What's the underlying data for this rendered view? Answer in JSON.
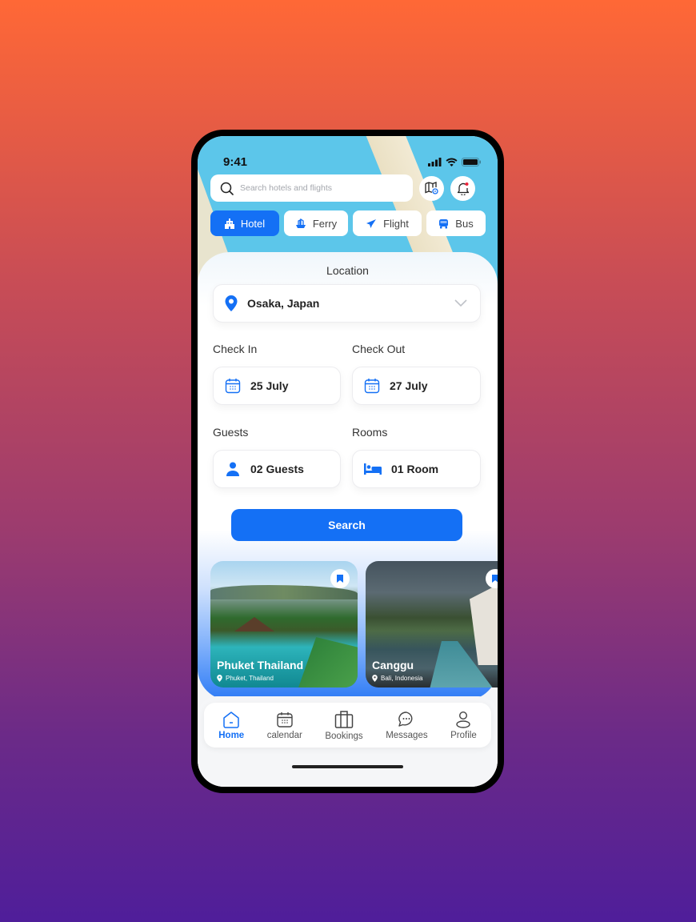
{
  "status_bar": {
    "time": "9:41"
  },
  "search": {
    "placeholder": "Search hotels and flights"
  },
  "header_icons": [
    "map-icon",
    "bell-icon"
  ],
  "tabs": [
    {
      "label": "Hotel",
      "icon": "hotel-icon",
      "active": true
    },
    {
      "label": "Ferry",
      "icon": "ferry-icon",
      "active": false
    },
    {
      "label": "Flight",
      "icon": "plane-icon",
      "active": false
    },
    {
      "label": "Bus",
      "icon": "bus-icon",
      "active": false
    }
  ],
  "form": {
    "location_label": "Location",
    "location_value": "Osaka, Japan",
    "check_in_label": "Check In",
    "check_in_value": "25 July",
    "check_out_label": "Check Out",
    "check_out_value": "27 July",
    "guests_label": "Guests",
    "guests_value": "02 Guests",
    "rooms_label": "Rooms",
    "rooms_value": "01 Room",
    "search_button": "Search"
  },
  "destinations": [
    {
      "name": "Phuket Thailand",
      "location": "Phuket, Thailand"
    },
    {
      "name": "Canggu",
      "location": "Bali, Indonesia"
    }
  ],
  "bottom_nav": [
    {
      "label": "Home",
      "icon": "home-icon",
      "active": true
    },
    {
      "label": "calendar",
      "icon": "calendar-icon",
      "active": false
    },
    {
      "label": "Bookings",
      "icon": "briefcase-icon",
      "active": false
    },
    {
      "label": "Messages",
      "icon": "chat-icon",
      "active": false
    },
    {
      "label": "Profile",
      "icon": "profile-icon",
      "active": false
    }
  ],
  "colors": {
    "accent": "#1470f5",
    "background_top": "#ff6836",
    "background_bottom": "#4f1e9a"
  }
}
